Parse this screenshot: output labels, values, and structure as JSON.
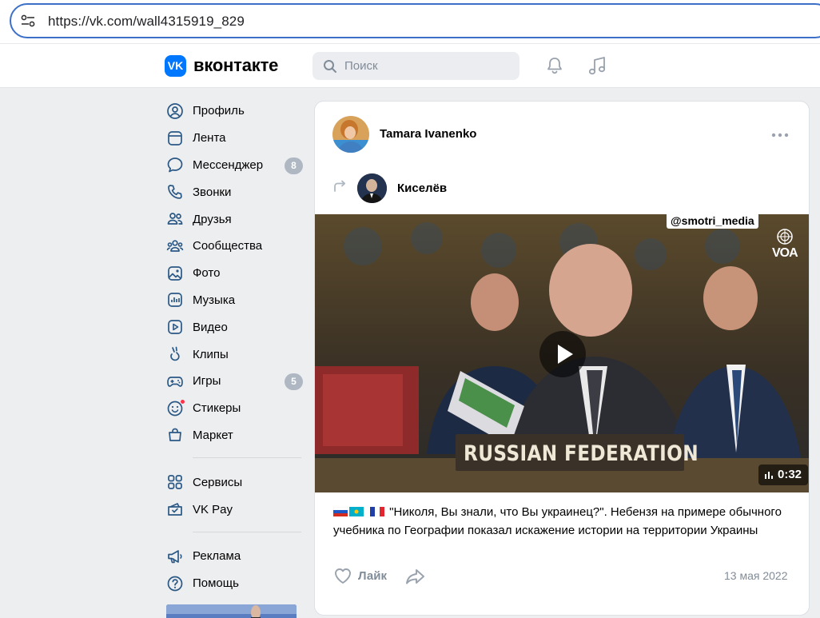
{
  "browser": {
    "url": "https://vk.com/wall4315919_829"
  },
  "header": {
    "logo_letter": "VK",
    "brand": "вконтакте",
    "search_placeholder": "Поиск",
    "icons": [
      "search-icon",
      "bell-icon",
      "music-note-icon"
    ]
  },
  "sidebar": {
    "items": [
      {
        "label": "Профиль",
        "icon": "profile-icon"
      },
      {
        "label": "Лента",
        "icon": "feed-icon"
      },
      {
        "label": "Мессенджер",
        "icon": "messenger-icon",
        "badge": "8"
      },
      {
        "label": "Звонки",
        "icon": "phone-icon"
      },
      {
        "label": "Друзья",
        "icon": "friends-icon"
      },
      {
        "label": "Сообщества",
        "icon": "communities-icon"
      },
      {
        "label": "Фото",
        "icon": "photo-icon"
      },
      {
        "label": "Музыка",
        "icon": "music-icon"
      },
      {
        "label": "Видео",
        "icon": "video-icon"
      },
      {
        "label": "Клипы",
        "icon": "clips-icon"
      },
      {
        "label": "Игры",
        "icon": "games-icon",
        "badge": "5"
      },
      {
        "label": "Стикеры",
        "icon": "stickers-icon"
      },
      {
        "label": "Маркет",
        "icon": "market-icon"
      }
    ],
    "items2": [
      {
        "label": "Сервисы",
        "icon": "services-icon"
      },
      {
        "label": "VK Pay",
        "icon": "vkpay-icon"
      }
    ],
    "items3": [
      {
        "label": "Реклама",
        "icon": "ads-icon"
      },
      {
        "label": "Помощь",
        "icon": "help-icon"
      }
    ]
  },
  "post": {
    "author": "Tamara Ivanenko",
    "repost_author": "Киселёв",
    "video": {
      "watermark": "@smotri_media",
      "channel_logo": "VOA",
      "plaque": "RUSSIAN FEDERATION",
      "duration": "0:32"
    },
    "text": "\"Николя, Вы знали, что Вы украинец?\". Небензя на примере обычного учебника по Географии показал искажение истории на территории Украины",
    "like_label": "Лайк",
    "date": "13 мая 2022"
  },
  "colors": {
    "accent": "#0077ff",
    "page_bg": "#edeef0",
    "muted_text": "#818c99",
    "badge": "#aeb7c2"
  }
}
